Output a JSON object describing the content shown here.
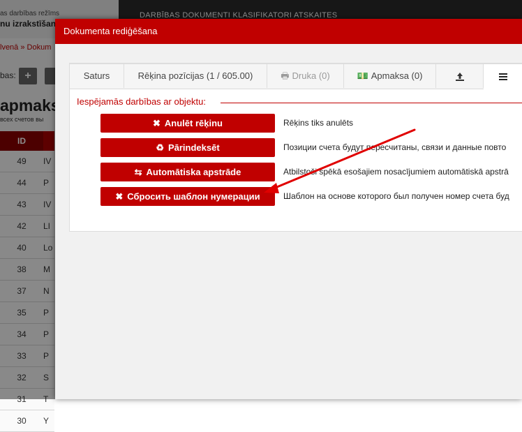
{
  "background": {
    "mode_label": "as darbības režīms",
    "mode_value": "nu izrakstīšan",
    "topnav": "DARBĪBAS   DOKUMENTI   KLASIFIKATORI   ATSKAITES",
    "breadcrumb": "lvenā  »  Dokum",
    "toolbar_label": "bas:",
    "add_label": "+",
    "page_title": "apmaks",
    "subtitle": "всех счетов вы",
    "table_header_id": "ID",
    "rows": [
      {
        "id": "49",
        "c": "IV"
      },
      {
        "id": "44",
        "c": "P"
      },
      {
        "id": "43",
        "c": "IV"
      },
      {
        "id": "42",
        "c": "LI"
      },
      {
        "id": "40",
        "c": "Lo"
      },
      {
        "id": "38",
        "c": "M"
      },
      {
        "id": "37",
        "c": "N"
      },
      {
        "id": "35",
        "c": "P"
      },
      {
        "id": "34",
        "c": "P"
      },
      {
        "id": "33",
        "c": "P"
      },
      {
        "id": "32",
        "c": "S"
      },
      {
        "id": "31",
        "c": "T"
      },
      {
        "id": "30",
        "c": "Y"
      }
    ]
  },
  "modal": {
    "title": "Dokumenta rediģēšana",
    "tabs": [
      {
        "label": "Saturs",
        "icon": ""
      },
      {
        "label": "Rēķina pozīcijas (1 / 605.00)",
        "icon": ""
      },
      {
        "label": "Druka (0)",
        "icon": "print-icon"
      },
      {
        "label": "Apmaksa (0)",
        "icon": "money-icon"
      },
      {
        "label": "",
        "icon": "upload-icon"
      },
      {
        "label": "",
        "icon": "menu-icon"
      }
    ],
    "legend": "Iespējamās darbības ar objektu:",
    "actions": [
      {
        "label": "Anulēt rēķinu",
        "icon": "close-icon",
        "description": "Rēķins tiks anulēts"
      },
      {
        "label": "Pārindeksēt",
        "icon": "recycle-icon",
        "description": "Позиции счета будут пересчитаны, связи и данные повто"
      },
      {
        "label": "Automātiska apstrāde",
        "icon": "exchange-icon",
        "description": "Atbilstoši spēkā esošajiem nosacījumiem automātiskā apstrā"
      },
      {
        "label": "Сбросить шаблон нумерации",
        "icon": "close-icon",
        "description": "Шаблон на основе которого был получен номер счета буд"
      }
    ],
    "arrow_color": "#e00000"
  }
}
